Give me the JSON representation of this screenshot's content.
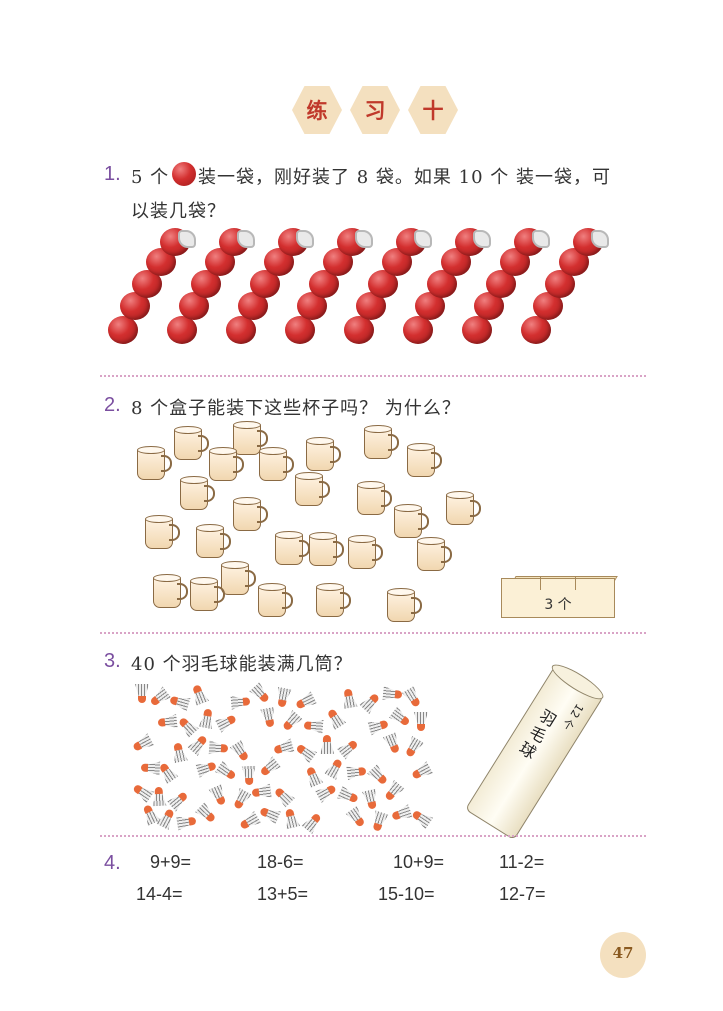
{
  "title": {
    "chars": [
      "练",
      "习",
      "十"
    ]
  },
  "q1": {
    "number": "1.",
    "line1_a": "5 个",
    "line1_b": "装一袋，刚好装了 8 袋。如果 10 个 装一袋，可",
    "line2": "以装几袋？"
  },
  "q2": {
    "number": "2.",
    "text": "8 个盒子能装下这些杯子吗？ 为什么？",
    "box_label": "3 个"
  },
  "q3": {
    "number": "3.",
    "text": "40 个羽毛球能装满几筒？",
    "tube_label": "羽毛球",
    "tube_count": "12 个"
  },
  "q4": {
    "number": "4.",
    "row1": [
      "9+9=",
      "18-6=",
      "10+9=",
      "11-2="
    ],
    "row2": [
      "14-4=",
      "13+5=",
      "15-10=",
      "12-7="
    ]
  },
  "page_number": "47",
  "colors": {
    "accent": "#7b4fa0",
    "apple": "#d32f2f",
    "title_bg": "#f4e0bf"
  }
}
